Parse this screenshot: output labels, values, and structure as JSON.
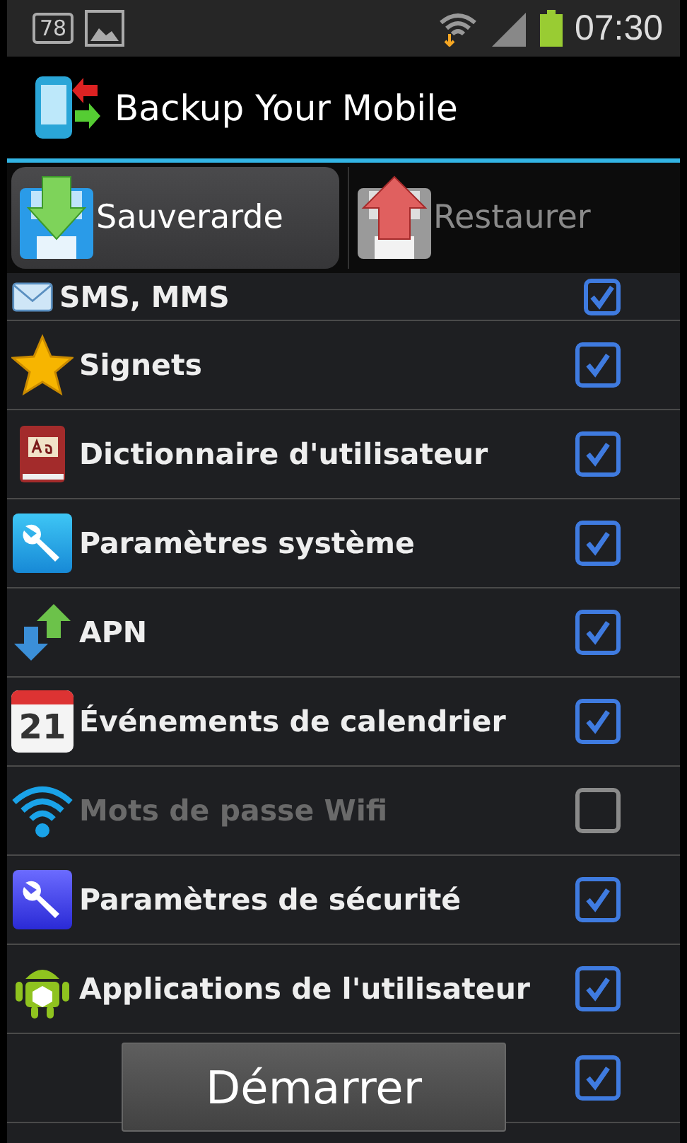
{
  "status_bar": {
    "notification_badge": "78",
    "time": "07:30"
  },
  "action_bar": {
    "title": "Backup Your Mobile"
  },
  "tabs": [
    {
      "label": "Sauverarde",
      "kind": "save",
      "selected": true
    },
    {
      "label": "Restaurer",
      "kind": "restore",
      "selected": false
    }
  ],
  "items": [
    {
      "label": "SMS, MMS",
      "kind": "mail",
      "checked": true,
      "disabled": false
    },
    {
      "label": "Signets",
      "kind": "star",
      "checked": true,
      "disabled": false
    },
    {
      "label": "Dictionnaire d'utilisateur",
      "kind": "book",
      "checked": true,
      "disabled": false
    },
    {
      "label": "Paramètres système",
      "kind": "wrench",
      "checked": true,
      "disabled": false
    },
    {
      "label": "APN",
      "kind": "arrows",
      "checked": true,
      "disabled": false
    },
    {
      "label": "Événements de calendrier",
      "kind": "calendar",
      "icon_text": "21",
      "checked": true,
      "disabled": false
    },
    {
      "label": "Mots de passe Wifi",
      "kind": "wifi",
      "checked": false,
      "disabled": true
    },
    {
      "label": "Paramètres de sécurité",
      "kind": "tool",
      "checked": true,
      "disabled": false
    },
    {
      "label": "Applications de l'utilisateur",
      "kind": "android",
      "checked": true,
      "disabled": false
    },
    {
      "kind": "blank",
      "checked": true,
      "disabled": false
    }
  ],
  "start_button": {
    "label": "Démarrer"
  }
}
